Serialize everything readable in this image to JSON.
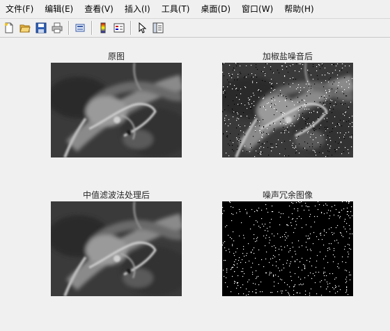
{
  "menu": [
    "文件(F)",
    "编辑(E)",
    "查看(V)",
    "插入(I)",
    "工具(T)",
    "桌面(D)",
    "窗口(W)",
    "帮助(H)"
  ],
  "toolbar": {
    "icons": [
      "new-figure-icon",
      "open-file-icon",
      "save-icon",
      "print-icon",
      "print-preview-icon",
      "colorbar-icon",
      "legend-icon",
      "pointer-icon",
      "property-editor-icon"
    ]
  },
  "panels": {
    "original": {
      "title": "原图"
    },
    "noisy": {
      "title": "加椒盐噪音后"
    },
    "filtered": {
      "title": "中值滤波法处理后"
    },
    "residual": {
      "title": "噪声冗余图像"
    }
  },
  "colors": {
    "background": "#f0f0f0",
    "image_black": "#000000",
    "noise_white": "#ffffff"
  }
}
